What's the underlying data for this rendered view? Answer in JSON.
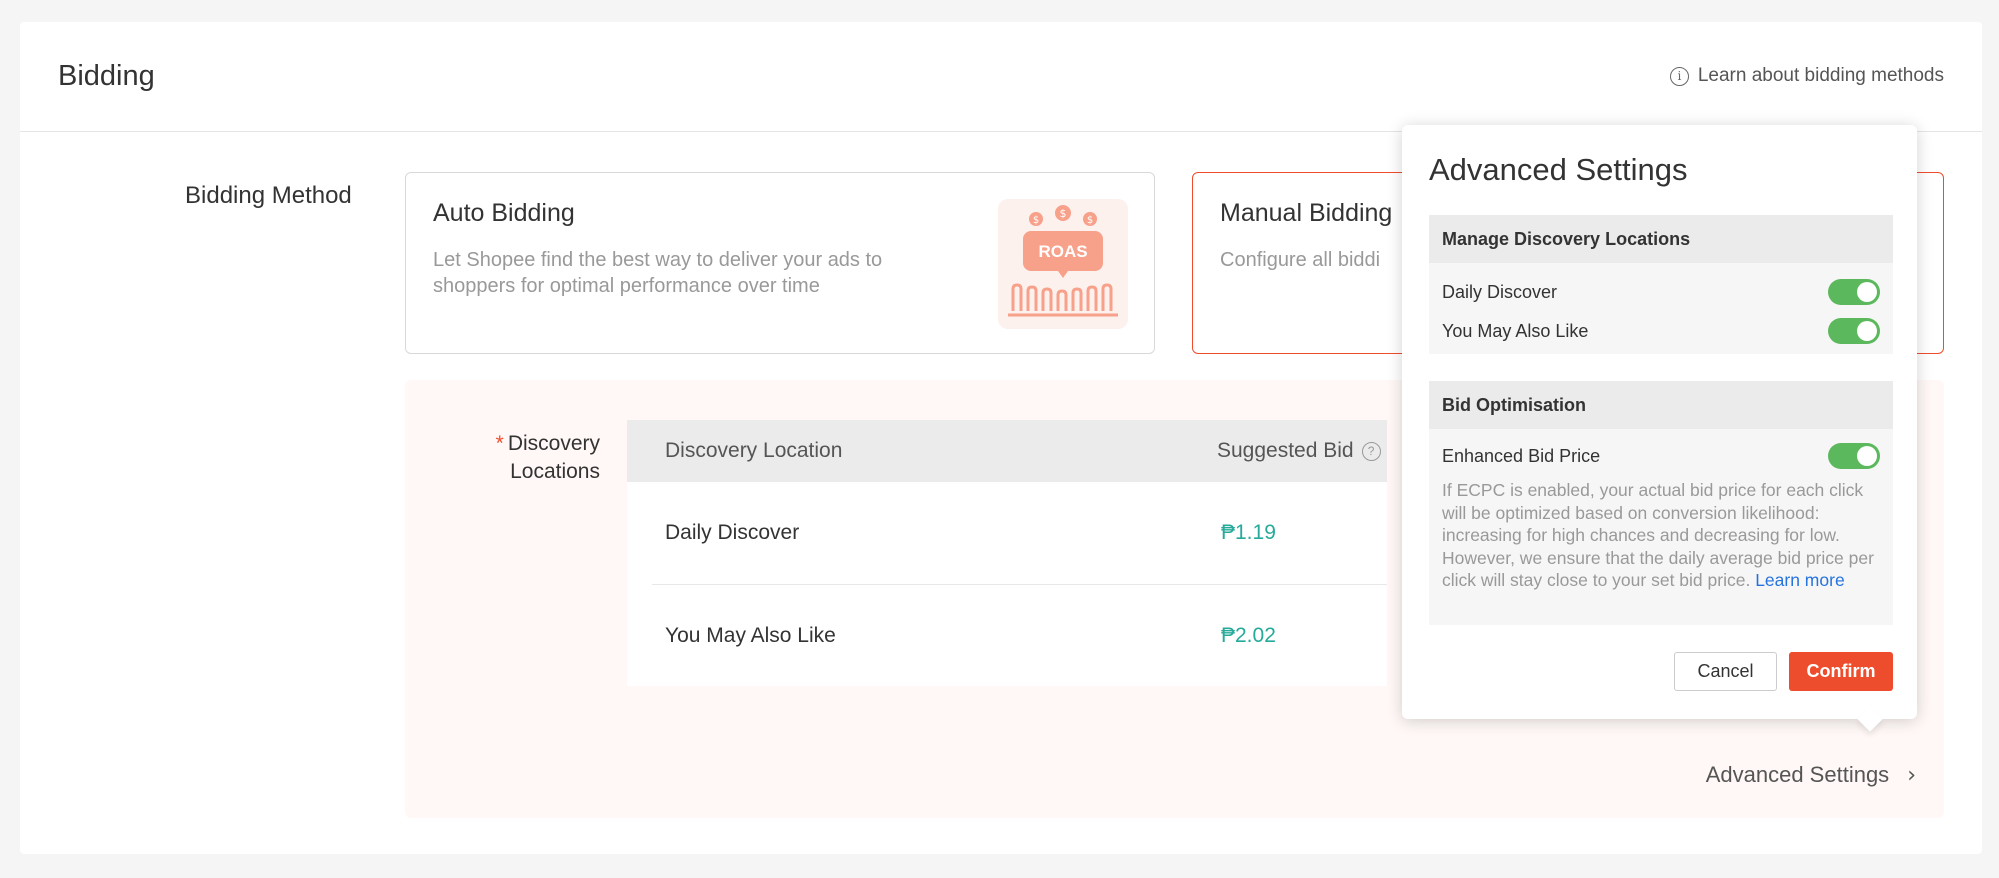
{
  "header": {
    "title": "Bidding",
    "learn_link": "Learn about bidding methods"
  },
  "bidding_method": {
    "label": "Bidding Method",
    "auto": {
      "title": "Auto Bidding",
      "description": "Let Shopee find the best way to deliver your ads to shoppers for optimal performance over time",
      "illustration_text": "ROAS"
    },
    "manual": {
      "title": "Manual Bidding",
      "description": "Configure all biddi"
    }
  },
  "discovery": {
    "label": "Discovery Locations",
    "required_mark": "*",
    "columns": [
      "Discovery Location",
      "Suggested Bid"
    ],
    "rows": [
      {
        "location": "Daily Discover",
        "bid": "₱1.19"
      },
      {
        "location": "You May Also Like",
        "bid": "₱2.02"
      }
    ],
    "advanced_link": "Advanced Settings"
  },
  "advanced_popover": {
    "title": "Advanced Settings",
    "manage_section": {
      "heading": "Manage Discovery Locations",
      "items": [
        {
          "label": "Daily Discover",
          "enabled": true
        },
        {
          "label": "You May Also Like",
          "enabled": true
        }
      ]
    },
    "bid_section": {
      "heading": "Bid Optimisation",
      "item": {
        "label": "Enhanced Bid Price",
        "enabled": true
      },
      "description": "If ECPC is enabled, your actual bid price for each click will be optimized based on conversion likelihood: increasing for high chances and decreasing for low. However, we ensure that the daily average bid price per click will stay close to your set bid price.",
      "learn_more": "Learn more"
    },
    "cancel_label": "Cancel",
    "confirm_label": "Confirm"
  },
  "colors": {
    "accent": "#ee4d2d",
    "bid_green": "#26aa99",
    "toggle_on": "#5cb85c",
    "link_blue": "#2673dd"
  }
}
